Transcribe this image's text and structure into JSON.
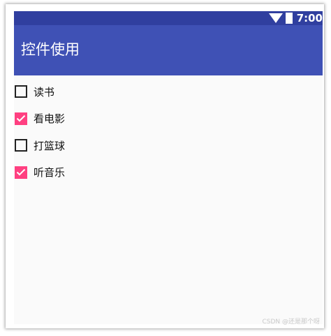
{
  "status_bar": {
    "time": "7:00",
    "wifi_icon": "wifi-icon",
    "battery_icon": "battery-icon",
    "color": "#303f9f"
  },
  "app_bar": {
    "title": "控件使用",
    "color": "#3f51b5"
  },
  "checkboxes": [
    {
      "label": "读书",
      "checked": false
    },
    {
      "label": "看电影",
      "checked": true
    },
    {
      "label": "打篮球",
      "checked": false
    },
    {
      "label": "听音乐",
      "checked": true
    }
  ],
  "accent_color": "#ff4081",
  "watermark": "CSDN @还是那个呀"
}
